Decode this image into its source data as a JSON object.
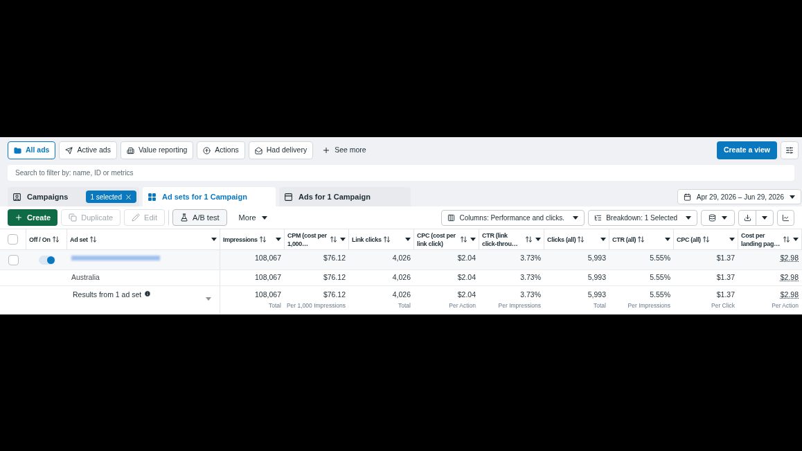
{
  "filters": [
    {
      "label": "All ads",
      "selected": true
    },
    {
      "label": "Active ads",
      "selected": false
    },
    {
      "label": "Value reporting",
      "selected": false
    },
    {
      "label": "Actions",
      "selected": false
    },
    {
      "label": "Had delivery",
      "selected": false
    }
  ],
  "see_more": "See more",
  "create_view": "Create a view",
  "search": {
    "placeholder": "Search to filter by: name, ID or metrics"
  },
  "levels": [
    {
      "label": "Campaigns",
      "selected": false,
      "badge": "1 selected"
    },
    {
      "label": "Ad sets for 1 Campaign",
      "selected": true
    },
    {
      "label": "Ads for 1 Campaign",
      "selected": false
    }
  ],
  "date_range": "Apr 29, 2026 – Jun 29, 2026",
  "toolbar": [
    {
      "label": "Create",
      "kind": "primary",
      "disabled": false
    },
    {
      "label": "Duplicate",
      "kind": "plain",
      "disabled": true
    },
    {
      "label": "Edit",
      "kind": "plain",
      "disabled": true
    },
    {
      "label": "A/B test",
      "kind": "plain",
      "disabled": false
    },
    {
      "label": "More",
      "kind": "menu",
      "disabled": false
    }
  ],
  "columns_button": "Columns: Performance and clicks.",
  "breakdown_button": "Breakdown: 1 Selected",
  "table": {
    "all_checked": false,
    "columns": [
      "Off / On",
      "Ad set",
      "Impressions",
      "CPM (cost per 1,000…",
      "Link clicks",
      "CPC (cost per link click)",
      "CTR (link click-throu…",
      "Clicks (all)",
      "CTR (all)",
      "CPC (all)",
      "Cost per landing pag…"
    ],
    "rows": [
      {
        "kind": "adset",
        "checked": false,
        "on": true,
        "cells": [
          "108,067",
          "$76.12",
          "4,026",
          "$2.04",
          "3.73%",
          "5,993",
          "5.55%",
          "$1.37",
          "$2.98"
        ]
      },
      {
        "kind": "breakdown",
        "name": "Australia",
        "cells": [
          "108,067",
          "$76.12",
          "4,026",
          "$2.04",
          "3.73%",
          "5,993",
          "5.55%",
          "$1.37",
          "$2.98"
        ]
      },
      {
        "kind": "summary",
        "name": "Results from 1 ad set",
        "cells": [
          "108,067",
          "$76.12",
          "4,026",
          "$2.04",
          "3.73%",
          "5,993",
          "5.55%",
          "$1.37",
          "$2.98"
        ],
        "notes": [
          "Total",
          "Per 1,000 Impressions",
          "Total",
          "Per Action",
          "Per Impressions",
          "Total",
          "Per Impressions",
          "Per Click",
          "Per Action"
        ]
      }
    ]
  }
}
